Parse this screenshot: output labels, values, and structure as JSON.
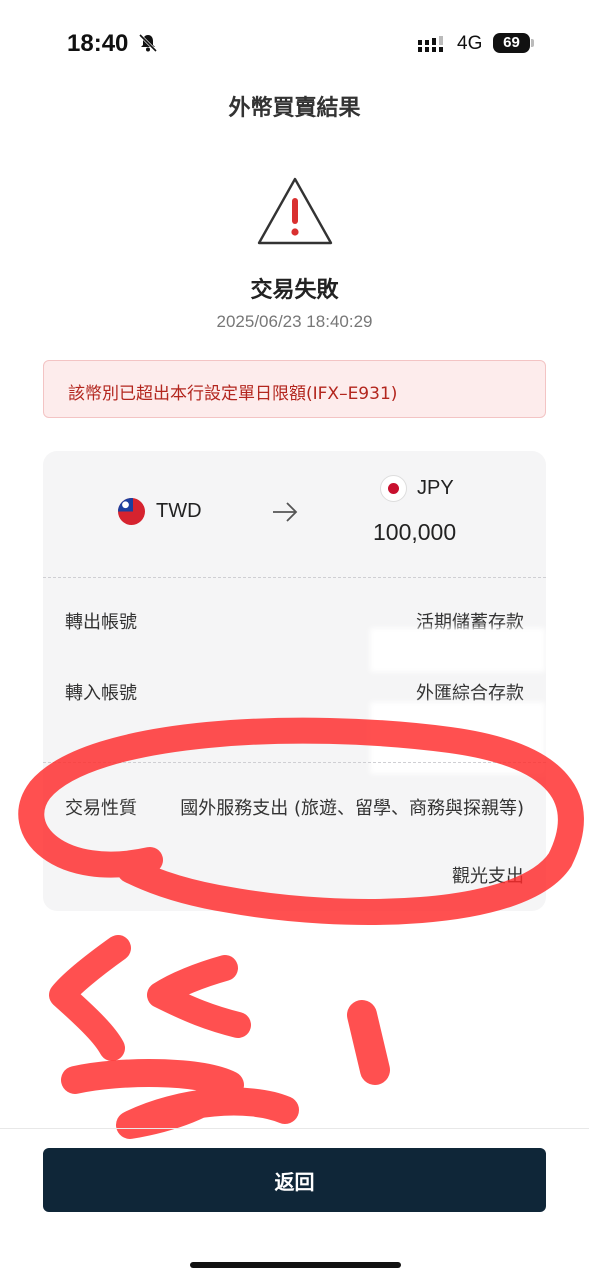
{
  "status_bar": {
    "time": "18:40",
    "network": "4G",
    "battery": "69",
    "icons": [
      "bell-slash-icon",
      "signal-icon",
      "battery-icon"
    ]
  },
  "page": {
    "title": "外幣買賣結果"
  },
  "result": {
    "icon": "warning-triangle-icon",
    "status": "交易失敗",
    "timestamp": "2025/06/23 18:40:29"
  },
  "error": {
    "message": "該幣別已超出本行設定單日限額(IFX–E931)"
  },
  "exchange": {
    "from_currency": "TWD",
    "to_currency": "JPY",
    "to_amount": "100,000",
    "arrow_icon": "arrow-right-icon"
  },
  "details": {
    "out_account_label": "轉出帳號",
    "out_account_value": "活期儲蓄存款",
    "in_account_label": "轉入帳號",
    "in_account_value": "外匯綜合存款",
    "purpose_label": "交易性質",
    "purpose_value": "國外服務支出 (旅遊、留學、商務與探親等)",
    "purpose_sub": "觀光支出"
  },
  "footer": {
    "back_label": "返回"
  },
  "colors": {
    "error_text": "#b3261e",
    "error_bg": "#fdecec",
    "button_bg": "#0f2638",
    "scribble": "#ff2a2a"
  }
}
